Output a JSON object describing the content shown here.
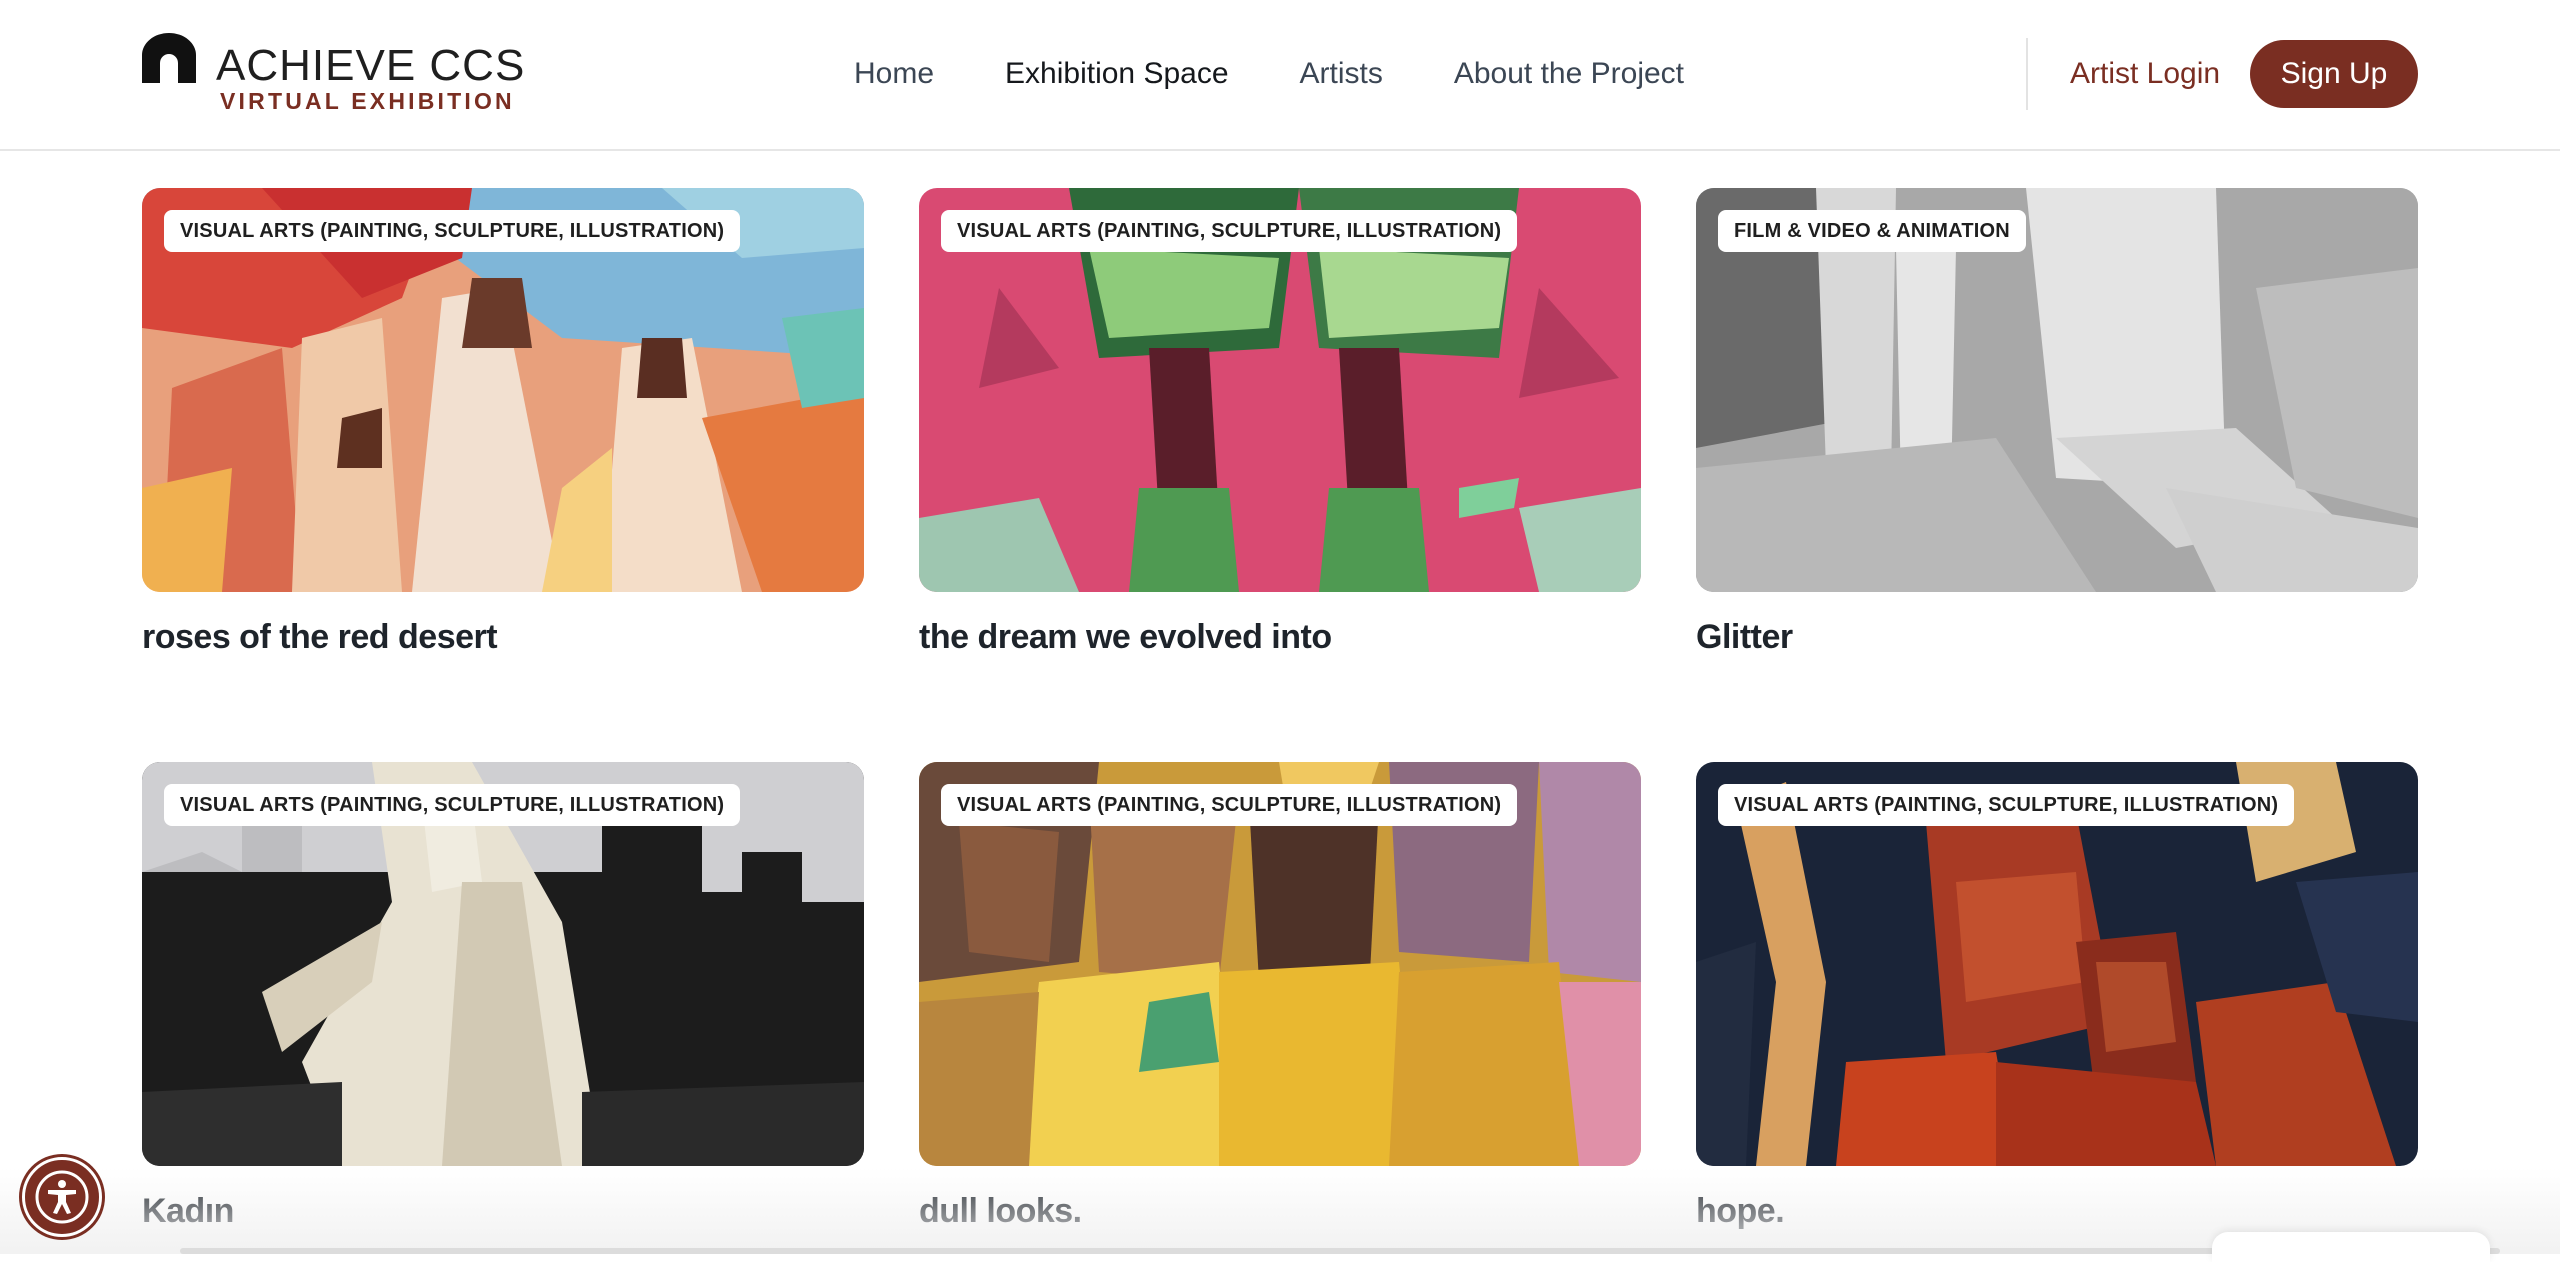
{
  "brand": {
    "title": "ACHIEVE CCS",
    "subtitle": "VIRTUAL EXHIBITION",
    "accent": "#7a2e22"
  },
  "nav": {
    "items": [
      {
        "label": "Home"
      },
      {
        "label": "Exhibition Space",
        "active": true
      },
      {
        "label": "Artists"
      },
      {
        "label": "About the Project"
      }
    ],
    "login_label": "Artist Login",
    "signup_label": "Sign Up"
  },
  "artworks": [
    {
      "category": "VISUAL ARTS (PAINTING, SCULPTURE, ILLUSTRATION)",
      "title": "roses of the red desert"
    },
    {
      "category": "VISUAL ARTS (PAINTING, SCULPTURE, ILLUSTRATION)",
      "title": "the dream we evolved into"
    },
    {
      "category": "FILM & VIDEO & ANIMATION",
      "title": "Glitter"
    },
    {
      "category": "VISUAL ARTS (PAINTING, SCULPTURE, ILLUSTRATION)",
      "title": "Kadın"
    },
    {
      "category": "VISUAL ARTS (PAINTING, SCULPTURE, ILLUSTRATION)",
      "title": "dull looks."
    },
    {
      "category": "VISUAL ARTS (PAINTING, SCULPTURE, ILLUSTRATION)",
      "title": "hope."
    }
  ],
  "icons": {
    "logo": "arch-logo-icon",
    "accessibility": "accessibility-icon"
  }
}
